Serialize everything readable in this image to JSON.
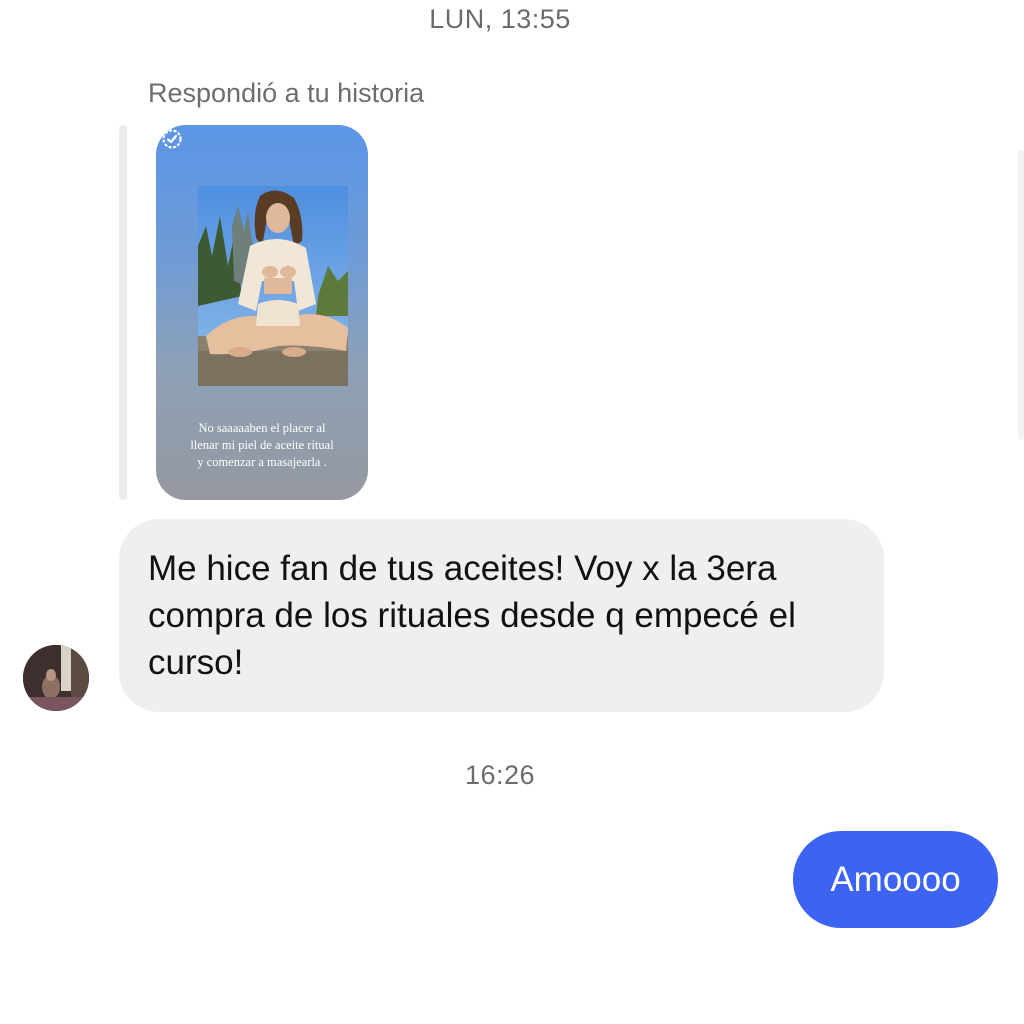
{
  "thread": {
    "timestamp_top": "LUN, 13:55",
    "timestamp_mid": "16:26"
  },
  "story_reply": {
    "label": "Respondió a tu historia",
    "caption_lines": [
      "No saaaaaben el placer al",
      "llenar mi piel de aceite ritual",
      "y comenzar a masajearla ."
    ],
    "check_icon": "check-badge-icon"
  },
  "messages": {
    "incoming_text": "Me hice fan de tus aceites! Voy x la 3era compra de los rituales desde q empecé el curso!",
    "outgoing_text": "Amoooo"
  },
  "colors": {
    "outgoing_bubble": "#3d63f2",
    "incoming_bubble": "#efefef",
    "timestamp_text": "#6b6b6b"
  }
}
